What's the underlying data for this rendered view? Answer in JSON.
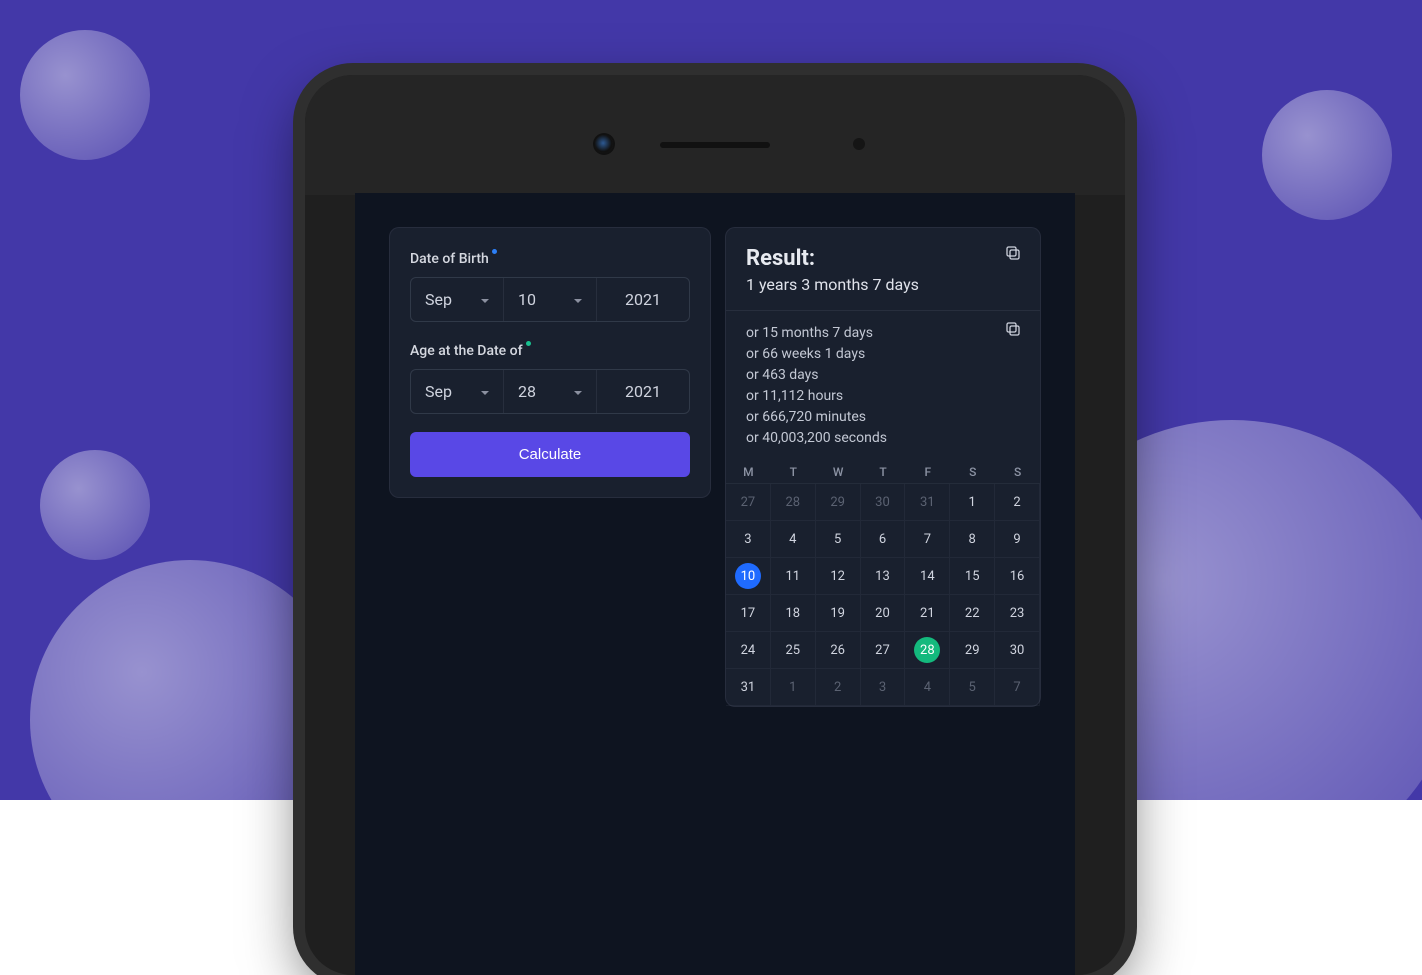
{
  "form": {
    "dob_label": "Date of Birth",
    "age_at_label": "Age at the Date of",
    "dob": {
      "month": "Sep",
      "day": "10",
      "year": "2021"
    },
    "target": {
      "month": "Sep",
      "day": "28",
      "year": "2021"
    },
    "calculate_label": "Calculate"
  },
  "result": {
    "title": "Result:",
    "main": "1 years 3 months 7 days",
    "lines": [
      "or 15 months 7 days",
      "or 66 weeks 1 days",
      "or 463 days",
      "or 11,112 hours",
      "or 666,720 minutes",
      "or 40,003,200 seconds"
    ]
  },
  "calendar": {
    "dow": [
      "M",
      "T",
      "W",
      "T",
      "F",
      "S",
      "S"
    ],
    "selected_blue": 10,
    "selected_green": 28,
    "cells": [
      {
        "n": 27,
        "dim": true
      },
      {
        "n": 28,
        "dim": true
      },
      {
        "n": 29,
        "dim": true
      },
      {
        "n": 30,
        "dim": true
      },
      {
        "n": 31,
        "dim": true
      },
      {
        "n": 1
      },
      {
        "n": 2
      },
      {
        "n": 3
      },
      {
        "n": 4
      },
      {
        "n": 5
      },
      {
        "n": 6
      },
      {
        "n": 7
      },
      {
        "n": 8
      },
      {
        "n": 9
      },
      {
        "n": 10,
        "mark": "blue"
      },
      {
        "n": 11
      },
      {
        "n": 12
      },
      {
        "n": 13
      },
      {
        "n": 14
      },
      {
        "n": 15
      },
      {
        "n": 16
      },
      {
        "n": 17
      },
      {
        "n": 18
      },
      {
        "n": 19
      },
      {
        "n": 20
      },
      {
        "n": 21
      },
      {
        "n": 22
      },
      {
        "n": 23
      },
      {
        "n": 24
      },
      {
        "n": 25
      },
      {
        "n": 26
      },
      {
        "n": 27
      },
      {
        "n": 28,
        "mark": "green"
      },
      {
        "n": 29
      },
      {
        "n": 30
      },
      {
        "n": 31
      },
      {
        "n": 1,
        "dim": true
      },
      {
        "n": 2,
        "dim": true
      },
      {
        "n": 3,
        "dim": true
      },
      {
        "n": 4,
        "dim": true
      },
      {
        "n": 5,
        "dim": true
      },
      {
        "n": 7,
        "dim": true
      }
    ]
  }
}
